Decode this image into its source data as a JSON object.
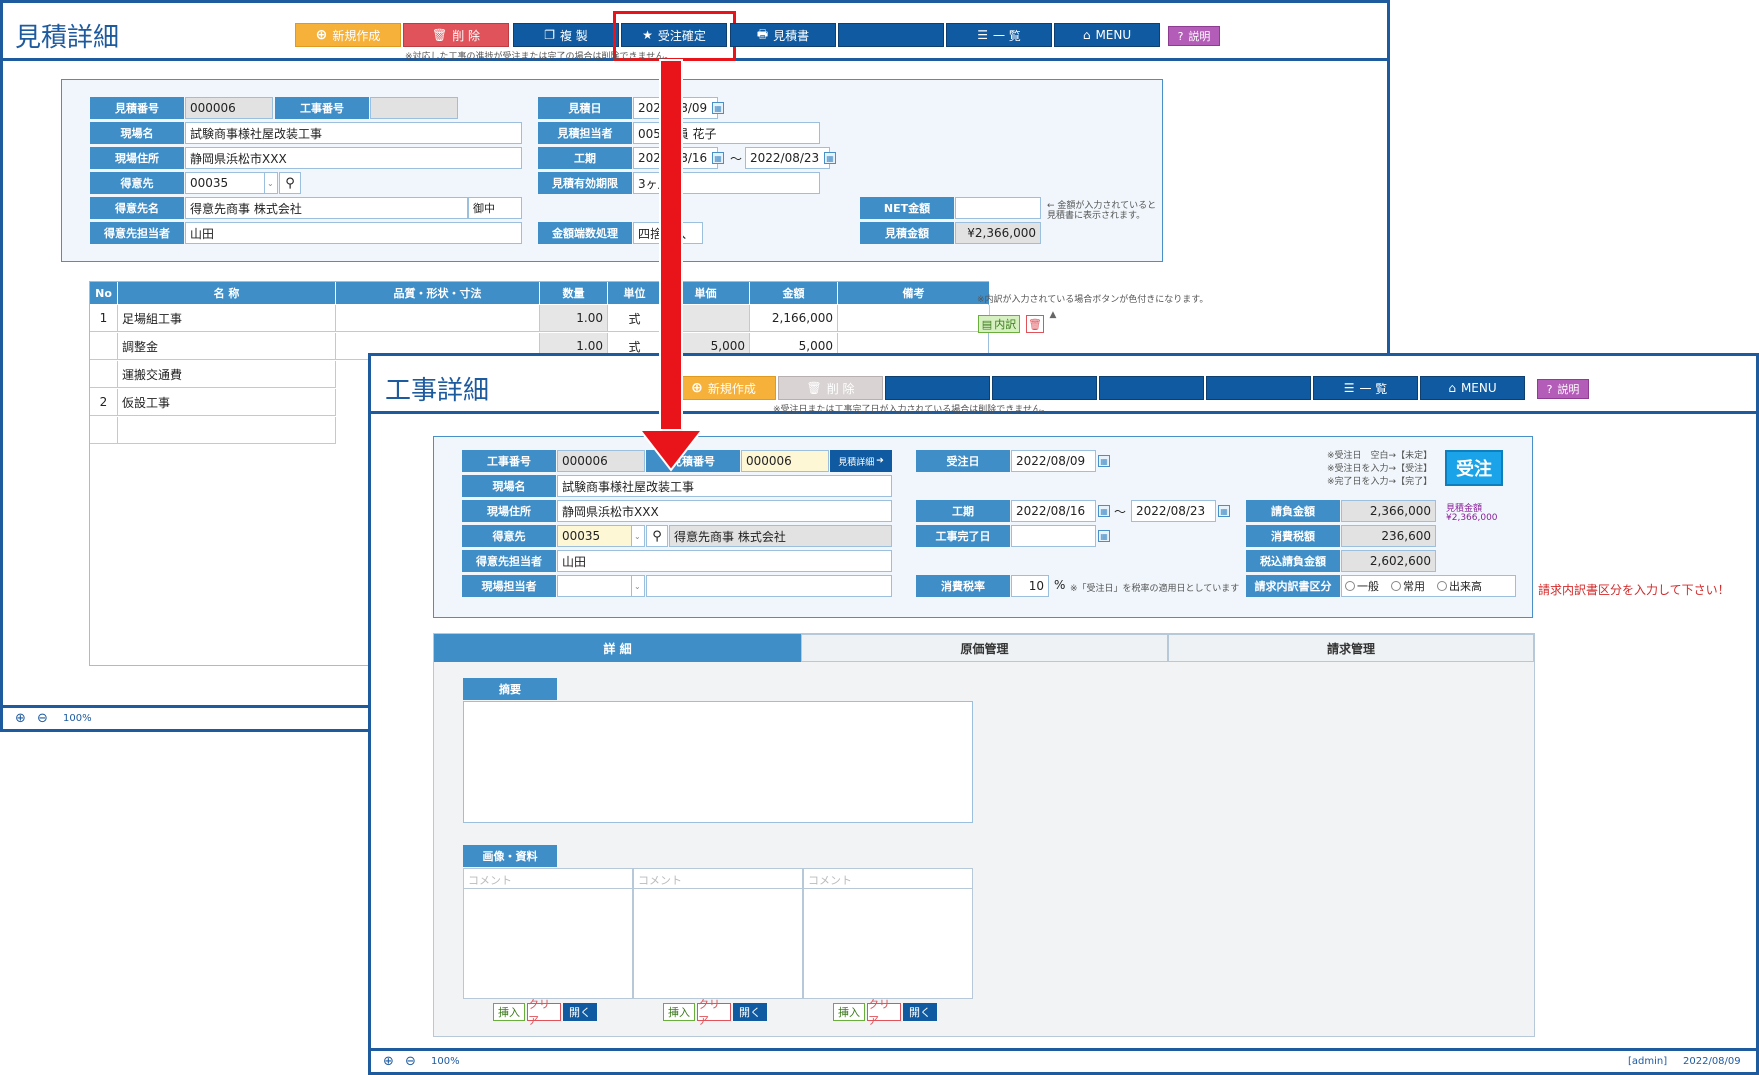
{
  "estimate_window": {
    "title": "見積詳細",
    "toolbar": {
      "new": "新規作成",
      "delete": "削 除",
      "copy": "複 製",
      "confirm_order": "受注確定",
      "quote": "見積書",
      "list": "一 覧",
      "menu": "MENU",
      "help": "説明"
    },
    "toolbar_note": "※対応した工事の進捗が受注または完了の場合は削除できません。",
    "form": {
      "estimate_no_label": "見積番号",
      "estimate_no": "000006",
      "work_no_label": "工事番号",
      "site_name_label": "現場名",
      "site_name": "試験商事様社屋改装工事",
      "site_address_label": "現場住所",
      "site_address": "静岡県浜松市XXX",
      "customer_label": "得意先",
      "customer": "00035",
      "customer_name_label": "得意先名",
      "customer_name": "得意先商事 株式会社",
      "honorific": "御中",
      "customer_contact_label": "得意先担当者",
      "customer_contact": "山田",
      "estimate_date_label": "見積日",
      "estimate_date": "2022/08/09",
      "staff_label": "見積担当者",
      "staff": "005 社員 花子",
      "period_label": "工期",
      "period_from": "2022/08/16",
      "period_sep": "～",
      "period_to": "2022/08/23",
      "validity_label": "見積有効期限",
      "validity": "3ヶ月",
      "rounding_label": "金額端数処理",
      "rounding": "四捨五入",
      "net_label": "NET金額",
      "estimate_amount_label": "見積金額",
      "estimate_amount": "¥2,366,000",
      "net_note": "← 金額が入力されていると見積書に表示されます。"
    },
    "table": {
      "headers": [
        "No",
        "名 称",
        "品質・形状・寸法",
        "数量",
        "単位",
        "単価",
        "金額",
        "備考"
      ],
      "note": "※内訳が入力されている場合ボタンが色付きになります。",
      "rows": [
        {
          "no": "1",
          "name": "足場組工事",
          "qty": "1.00",
          "unit": "式",
          "price": "",
          "amount": "2,166,000"
        },
        {
          "no": "",
          "name": "調整金",
          "qty": "1.00",
          "unit": "式",
          "price": "5,000",
          "amount": "5,000"
        },
        {
          "no": "",
          "name": "運搬交通費",
          "qty": "",
          "unit": "",
          "price": "",
          "amount": ""
        },
        {
          "no": "2",
          "name": "仮設工事",
          "qty": "",
          "unit": "",
          "price": "",
          "amount": ""
        }
      ],
      "breakdown_btn": "内訳"
    },
    "zoom": "100%"
  },
  "work_window": {
    "title": "工事詳細",
    "toolbar": {
      "new": "新規作成",
      "delete": "削 除",
      "list": "一 覧",
      "menu": "MENU",
      "help": "説明"
    },
    "toolbar_note": "※受注日または工事完了日が入力されている場合は削除できません。",
    "form": {
      "work_no_label": "工事番号",
      "work_no": "000006",
      "estimate_no_label": "見積番号",
      "estimate_no": "000006",
      "estimate_detail_btn": "見積詳細",
      "site_name_label": "現場名",
      "site_name": "試験商事様社屋改装工事",
      "site_address_label": "現場住所",
      "site_address": "静岡県浜松市XXX",
      "customer_label": "得意先",
      "customer": "00035",
      "customer_name": "得意先商事 株式会社",
      "customer_contact_label": "得意先担当者",
      "customer_contact": "山田",
      "site_staff_label": "現場担当者",
      "order_date_label": "受注日",
      "order_date": "2022/08/09",
      "period_label": "工期",
      "period_from": "2022/08/16",
      "period_sep": "～",
      "period_to": "2022/08/23",
      "completion_label": "工事完了日",
      "tax_rate_label": "消費税率",
      "tax_rate": "10",
      "tax_unit": "%",
      "tax_note": "※「受注日」を税率の適用日としています",
      "status_note_1": "※受注日　空白→【未定】",
      "status_note_2": "※受注日を入力→【受注】",
      "status_note_3": "※完了日を入力→【完了】",
      "status_badge": "受注",
      "contract_label": "請負金額",
      "contract": "2,366,000",
      "estimate_amount_caption": "見積金額",
      "estimate_amount_small": "¥2,366,000",
      "tax_label": "消費税額",
      "tax": "236,600",
      "total_label": "税込請負金額",
      "total": "2,602,600",
      "invoice_type_label": "請求内訳書区分",
      "invoice_options": [
        "一般",
        "常用",
        "出来高"
      ],
      "invoice_warning": "請求内訳書区分を入力して下さい！"
    },
    "tabs": [
      "詳 細",
      "原価管理",
      "請求管理"
    ],
    "summary_label": "摘要",
    "images_label": "画像・資料",
    "comment_placeholder": "コメント",
    "img_buttons": {
      "insert": "挿入",
      "clear": "クリア",
      "open": "開く"
    },
    "zoom": "100%",
    "footer_user": "[admin]",
    "footer_date": "2022/08/09"
  },
  "colors": {
    "primary": "#1d5a9e",
    "label_blue": "#3f8ec8",
    "arrow_red": "#e8141a",
    "badge_cyan": "#1aa3e8"
  }
}
